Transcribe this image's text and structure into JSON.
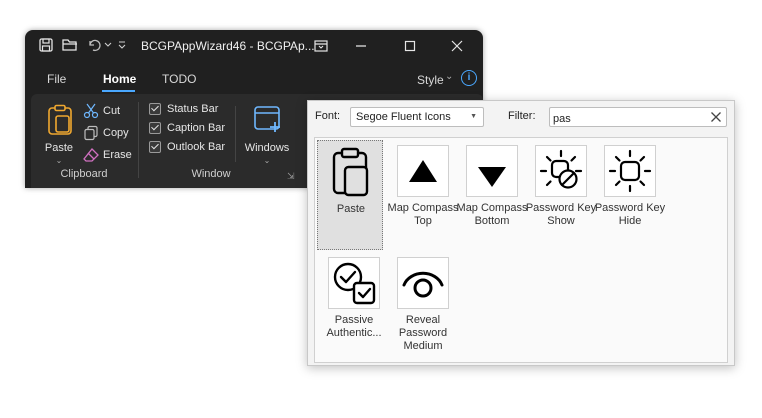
{
  "app": {
    "title": "BCGPAppWizard46 - BCGPAp...",
    "menu": [
      {
        "label": "File",
        "active": false
      },
      {
        "label": "Home",
        "active": true
      },
      {
        "label": "TODO",
        "active": false
      }
    ],
    "style_label": "Style",
    "info_glyph": "i",
    "ribbon": {
      "clipboard": {
        "group_label": "Clipboard",
        "paste_label": "Paste",
        "cut_label": "Cut",
        "copy_label": "Copy",
        "erase_label": "Erase"
      },
      "window": {
        "group_label": "Window",
        "status_bar_label": "Status Bar",
        "caption_bar_label": "Caption Bar",
        "outlook_bar_label": "Outlook Bar",
        "windows_label": "Windows"
      }
    },
    "colors": {
      "accent": "#4aa8ff",
      "paste_icon": "#f0a830",
      "erase_icon": "#d070c0"
    }
  },
  "dialog": {
    "font_label": "Font:",
    "font_value": "Segoe Fluent Icons",
    "filter_label": "Filter:",
    "filter_value": "pas",
    "icons": [
      {
        "name": "paste",
        "label": "Paste",
        "selected": true
      },
      {
        "name": "map-compass-top",
        "label": "Map Compass Top",
        "selected": false
      },
      {
        "name": "map-compass-bottom",
        "label": "Map Compass Bottom",
        "selected": false
      },
      {
        "name": "password-key-show",
        "label": "Password Key Show",
        "selected": false
      },
      {
        "name": "password-key-hide",
        "label": "Password Key Hide",
        "selected": false
      },
      {
        "name": "passive-authentication",
        "label": "Passive Authentic...",
        "selected": false
      },
      {
        "name": "reveal-password-medium",
        "label": "Reveal Password Medium",
        "selected": false
      }
    ]
  }
}
